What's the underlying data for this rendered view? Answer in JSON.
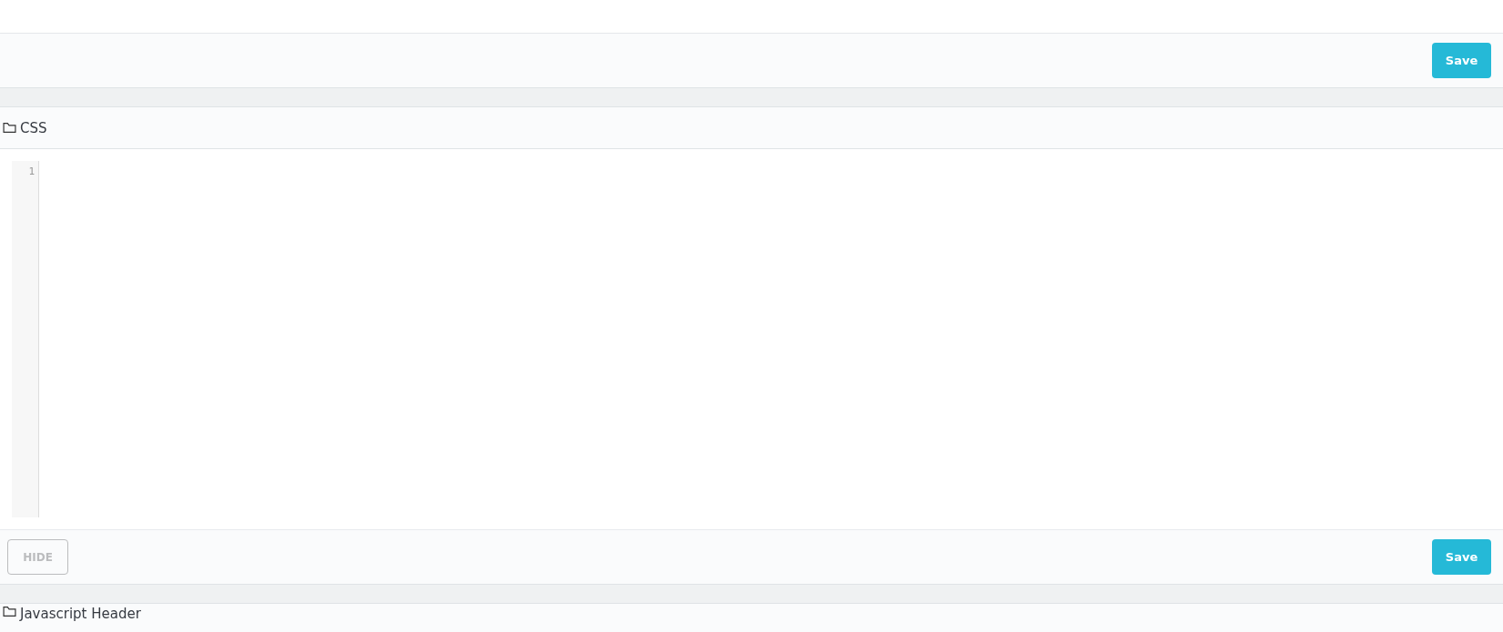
{
  "top_panel": {
    "save_button": "Save"
  },
  "css_panel": {
    "title": "CSS",
    "editor": {
      "line_numbers": [
        "1"
      ]
    },
    "hide_button": "HIDE",
    "save_button": "Save"
  },
  "next_panel": {
    "title": "Javascript Header"
  }
}
